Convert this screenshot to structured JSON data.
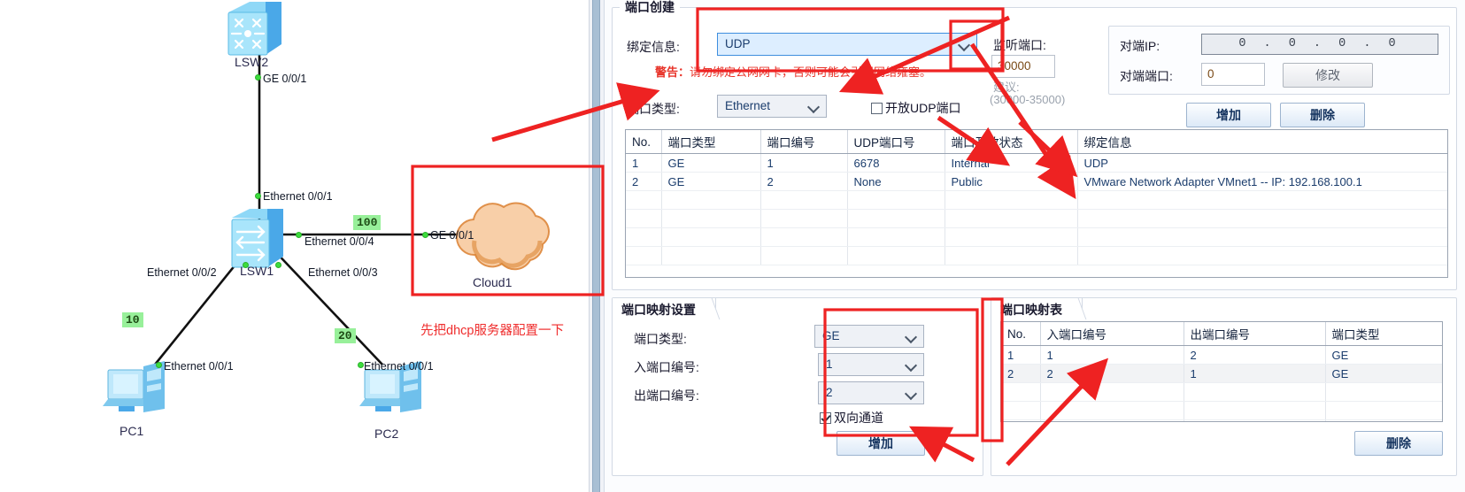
{
  "topology": {
    "devices": [
      {
        "name": "LSW2",
        "type": "switch-core-icon"
      },
      {
        "name": "LSW1",
        "type": "switch-icon"
      },
      {
        "name": "Cloud1",
        "type": "cloud-icon"
      },
      {
        "name": "PC1",
        "type": "pc-icon"
      },
      {
        "name": "PC2",
        "type": "pc-icon"
      }
    ],
    "interfaces": [
      {
        "label": "GE 0/0/1"
      },
      {
        "label": "Ethernet 0/0/1"
      },
      {
        "label": "Ethernet 0/0/4"
      },
      {
        "label": "GE 0/0/1"
      },
      {
        "label": "Ethernet 0/0/2"
      },
      {
        "label": "Ethernet 0/0/3"
      },
      {
        "label": "Ethernet 0/0/1"
      },
      {
        "label": "Ethernet 0/0/1"
      }
    ],
    "vlan_tags": [
      {
        "value": "100"
      },
      {
        "value": "10"
      },
      {
        "value": "20"
      }
    ],
    "annotation_note": "先把dhcp服务器配置一下"
  },
  "dialog": {
    "port_create": {
      "title": "端口创建",
      "bind_info_label": "绑定信息:",
      "bind_info_value": "UDP",
      "warning_prefix": "警告：",
      "warning_text": "请勿绑定公网网卡，否则可能会引起网络雍塞。",
      "port_type_label": "端口类型:",
      "port_type_value": "Ethernet",
      "udp_open_checkbox": "开放UDP端口",
      "udp_open_checked": false,
      "listen_port_label": "监听端口:",
      "listen_port_value": "30000",
      "suggest_label": "建议:",
      "suggest_range": "(30000-35000)",
      "peer_ip_label": "对端IP:",
      "peer_ip_value": "0 . 0 . 0 . 0",
      "peer_port_label": "对端端口:",
      "peer_port_value": "0",
      "modify_button": "修改",
      "add_button": "增加",
      "delete_button": "删除",
      "table": {
        "headers": [
          "No.",
          "端口类型",
          "端口编号",
          "UDP端口号",
          "端口开放状态",
          "绑定信息"
        ],
        "rows": [
          [
            "1",
            "GE",
            "1",
            "6678",
            "Internal",
            "UDP"
          ],
          [
            "2",
            "GE",
            "2",
            "None",
            "Public",
            "VMware Network Adapter VMnet1 -- IP: 192.168.100.1"
          ]
        ],
        "empty_rows": 4
      }
    },
    "port_mapping_settings": {
      "title": "端口映射设置",
      "port_type_label": "端口类型:",
      "port_type_value": "GE",
      "in_port_label": "入端口编号:",
      "in_port_value": "1",
      "out_port_label": "出端口编号:",
      "out_port_value": "2",
      "bidirectional_checkbox": "双向通道",
      "bidirectional_checked": true,
      "add_button": "增加"
    },
    "port_mapping_table": {
      "title": "端口映射表",
      "headers": [
        "No.",
        "入端口编号",
        "出端口编号",
        "端口类型"
      ],
      "rows": [
        [
          "1",
          "1",
          "2",
          "GE"
        ],
        [
          "2",
          "2",
          "1",
          "GE"
        ]
      ],
      "empty_rows": 3,
      "delete_button": "删除"
    }
  },
  "colors": {
    "annotation_red": "#ee2222",
    "vlan_green": "#98f09a",
    "accent_blue": "#3e8ede",
    "warning_red": "#e8342a"
  }
}
